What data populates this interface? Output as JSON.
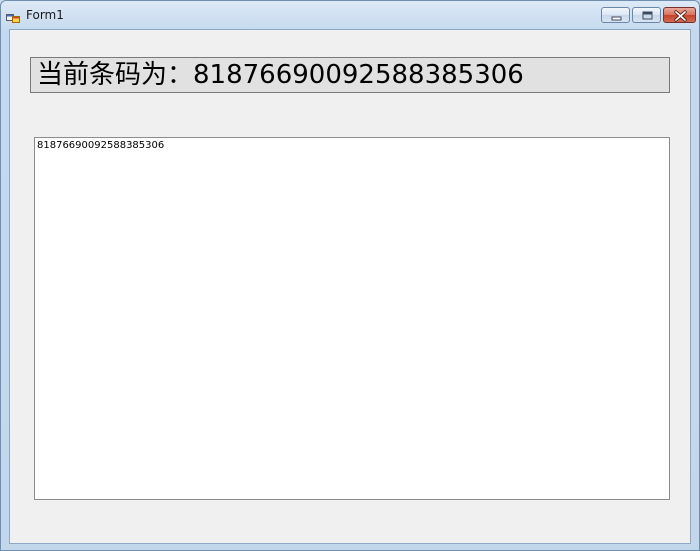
{
  "window": {
    "title": "Form1",
    "icon": "winforms-app-icon",
    "controls": {
      "minimize_icon": "minimize-icon",
      "maximize_icon": "maximize-icon",
      "close_icon": "close-icon"
    },
    "colors": {
      "frame": "#c5d9ee",
      "client_bg": "#f0f0f0",
      "close_button": "#c4432b"
    }
  },
  "form": {
    "barcode_label": "当前条码为：81876690092588385306",
    "output_text": "81876690092588385306"
  }
}
